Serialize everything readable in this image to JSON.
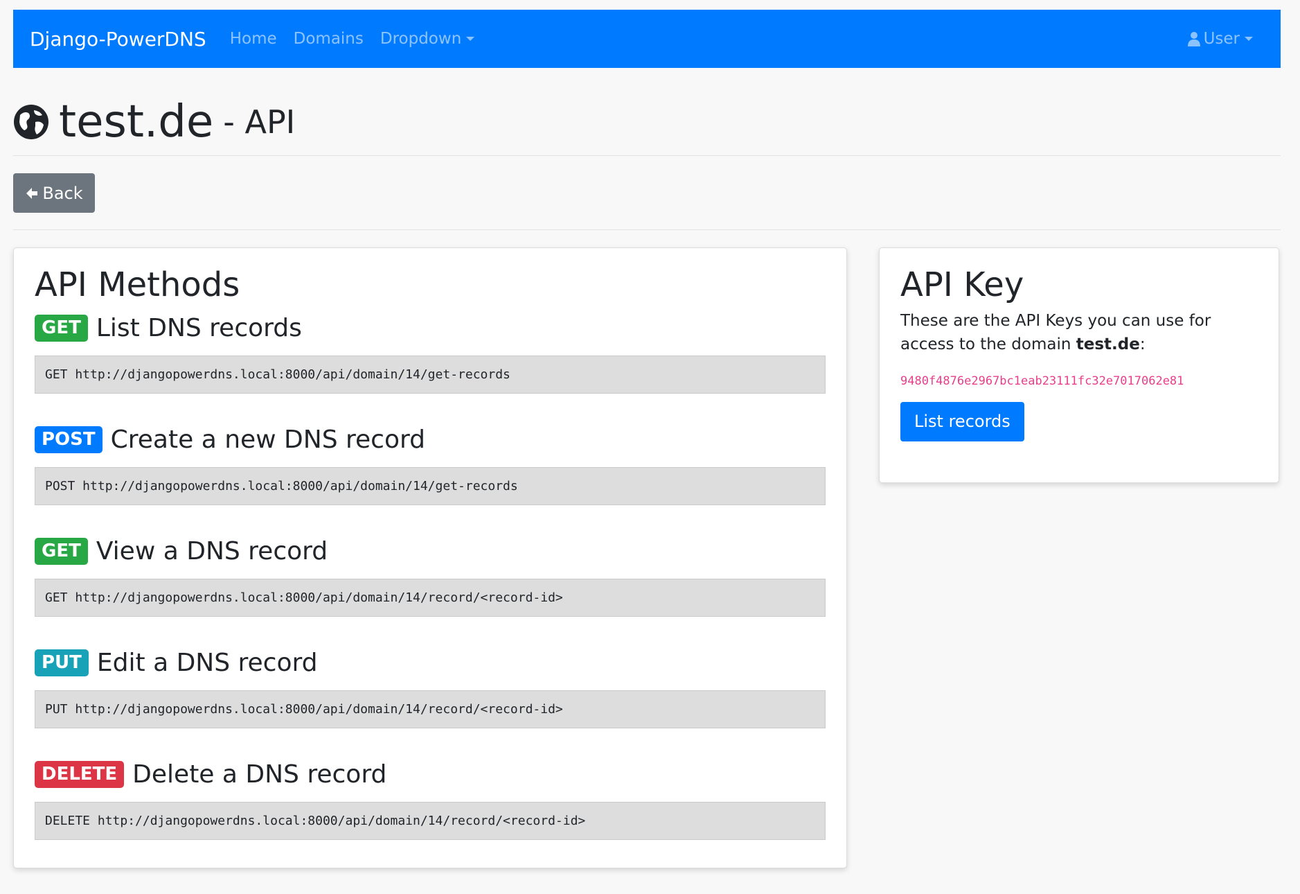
{
  "navbar": {
    "brand": "Django-PowerDNS",
    "links": [
      {
        "label": "Home"
      },
      {
        "label": "Domains"
      },
      {
        "label": "Dropdown"
      }
    ],
    "user_label": "User",
    "color": "#007bff"
  },
  "header": {
    "icon": "globe-icon",
    "domain": "test.de",
    "suffix": "- API"
  },
  "back_button": {
    "label": "Back",
    "icon": "arrow-left-icon"
  },
  "methods_card": {
    "title": "API Methods",
    "methods": [
      {
        "verb": "GET",
        "title": "List DNS records",
        "code": "GET http://djangopowerdns.local:8000/api/domain/14/get-records",
        "color": "#28a745"
      },
      {
        "verb": "POST",
        "title": "Create a new DNS record",
        "code": "POST http://djangopowerdns.local:8000/api/domain/14/get-records",
        "color": "#007bff"
      },
      {
        "verb": "GET",
        "title": "View a DNS record",
        "code": "GET http://djangopowerdns.local:8000/api/domain/14/record/<record-id>",
        "color": "#28a745"
      },
      {
        "verb": "PUT",
        "title": "Edit a DNS record",
        "code": "PUT http://djangopowerdns.local:8000/api/domain/14/record/<record-id>",
        "color": "#17a2b8"
      },
      {
        "verb": "DELETE",
        "title": "Delete a DNS record",
        "code": "DELETE http://djangopowerdns.local:8000/api/domain/14/record/<record-id>",
        "color": "#dc3545"
      }
    ]
  },
  "key_card": {
    "title": "API Key",
    "text_before": "These are the API Keys you can use for access to the domain ",
    "domain": "test.de",
    "text_after": ":",
    "key": "9480f4876e2967bc1eab23111fc32e7017062e81",
    "button_label": "List records"
  }
}
